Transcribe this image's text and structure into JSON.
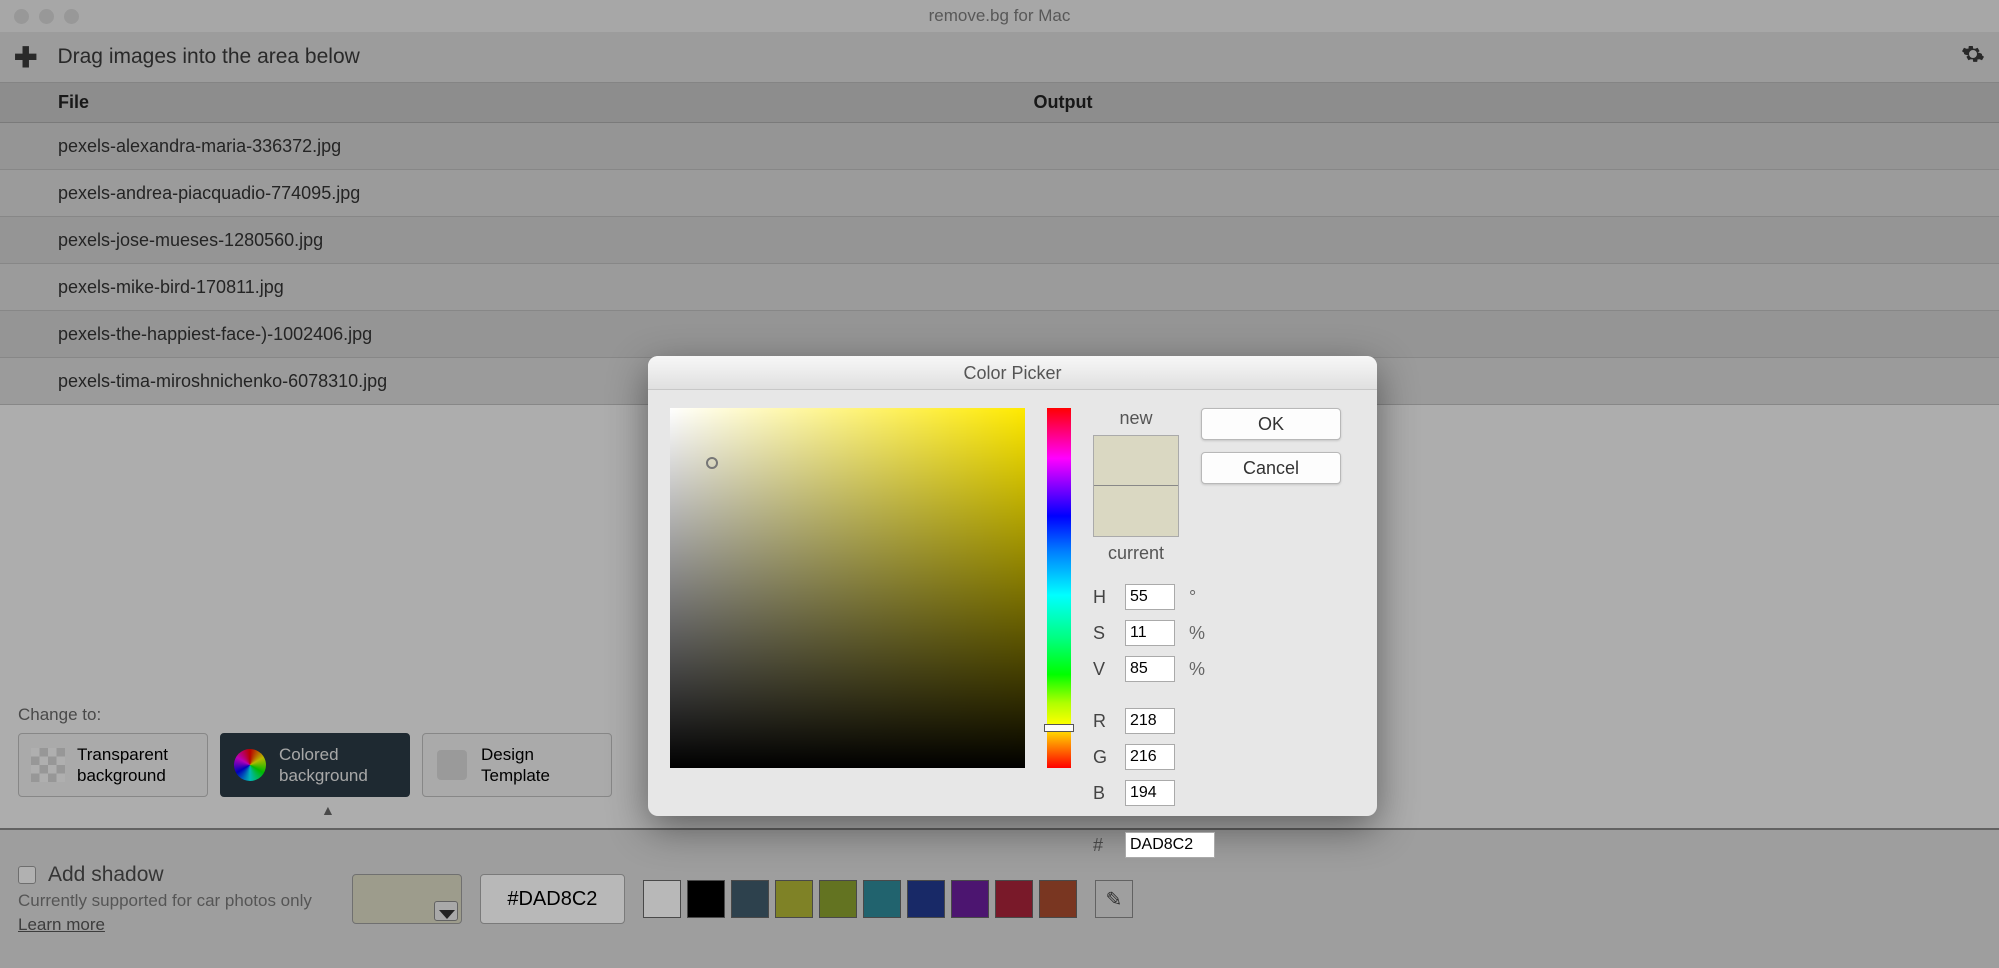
{
  "app_title": "remove.bg for Mac",
  "toolbar": {
    "drag_hint": "Drag images into the area below"
  },
  "table": {
    "headers": {
      "file": "File",
      "output": "Output"
    },
    "files": [
      "pexels-alexandra-maria-336372.jpg",
      "pexels-andrea-piacquadio-774095.jpg",
      "pexels-jose-mueses-1280560.jpg",
      "pexels-mike-bird-170811.jpg",
      "pexels-the-happiest-face-)-1002406.jpg",
      "pexels-tima-miroshnichenko-6078310.jpg"
    ]
  },
  "change_to": {
    "label": "Change to:",
    "options": {
      "transparent": {
        "line1": "Transparent",
        "line2": "background"
      },
      "colored": {
        "line1": "Colored",
        "line2": "background"
      },
      "template": {
        "line1": "Design",
        "line2": "Template"
      }
    }
  },
  "footer": {
    "add_shadow": "Add shadow",
    "shadow_sub": "Currently supported for car photos only",
    "learn_more": "Learn more",
    "hex": "#DAD8C2",
    "palette": [
      "#ffffff",
      "#000000",
      "#3f5a6b",
      "#b0b535",
      "#8aa02e",
      "#2e8a99",
      "#223a8f",
      "#6a1e9c",
      "#a8233a",
      "#a84b2e"
    ]
  },
  "picker": {
    "title": "Color Picker",
    "preview": {
      "new_label": "new",
      "current_label": "current"
    },
    "buttons": {
      "ok": "OK",
      "cancel": "Cancel"
    },
    "hsv": {
      "H": "55",
      "S": "11",
      "V": "85"
    },
    "rgb": {
      "R": "218",
      "G": "216",
      "B": "194"
    },
    "hex": "DAD8C2",
    "selected_color": "#DAD8C2"
  }
}
